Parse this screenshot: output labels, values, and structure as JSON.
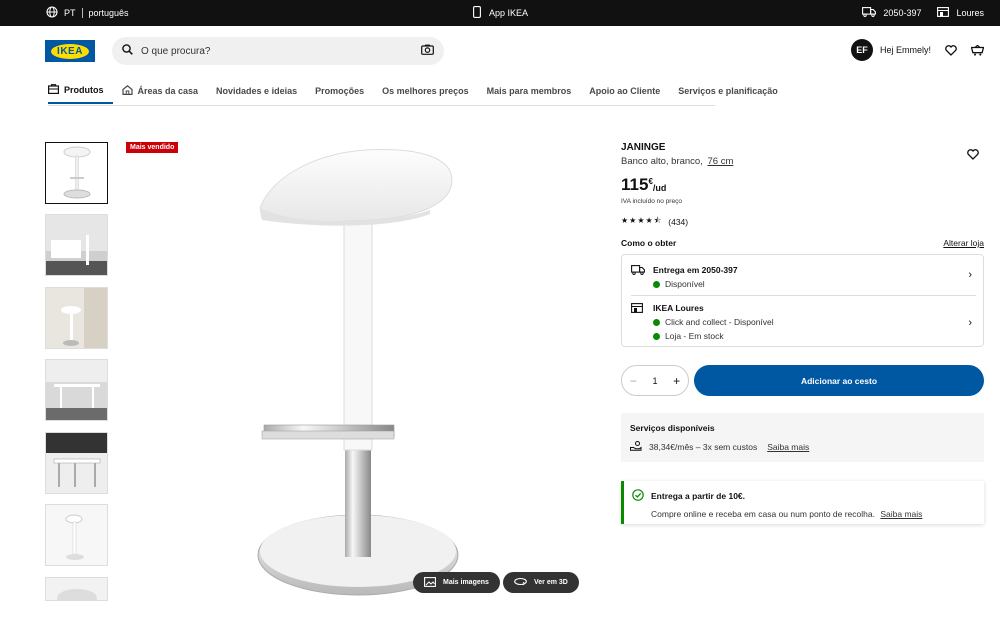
{
  "topbar": {
    "lang_code": "PT",
    "lang_name": "português",
    "app_label": "App IKEA",
    "postcode": "2050-397",
    "store": "Loures"
  },
  "header": {
    "logo_text": "IKEA",
    "search_placeholder": "O que procura?",
    "avatar_initials": "EF",
    "greeting": "Hej Emmely!"
  },
  "nav": {
    "tabs": [
      {
        "label": "Produtos"
      },
      {
        "label": "Áreas da casa"
      },
      {
        "label": "Novidades e ideias"
      },
      {
        "label": "Promoções"
      },
      {
        "label": "Os melhores preços"
      },
      {
        "label": "Mais para membros"
      },
      {
        "label": "Apoio ao Cliente"
      },
      {
        "label": "Serviços e planificação"
      }
    ]
  },
  "gallery": {
    "badge": "Mais vendido",
    "more_images": "Mais imagens",
    "view_3d": "Ver em 3D"
  },
  "product": {
    "name": "JANINGE",
    "description": "Banco alto, branco,",
    "size_link": "76 cm",
    "price_whole": "115",
    "price_currency": "€",
    "price_unit": "/ud",
    "vat_note": "IVA incluído no preço",
    "rating_value": 4.5,
    "rating_count": "(434)"
  },
  "delivery": {
    "section_title": "Como o obter",
    "change_store": "Alterar loja",
    "home_title": "Entrega em 2050-397",
    "home_status": "Disponível",
    "store_title": "IKEA Loures",
    "store_status_1": "Click and collect - Disponível",
    "store_status_2": "Loja - Em stock"
  },
  "purchase": {
    "quantity": "1",
    "add_to_cart": "Adicionar ao cesto"
  },
  "services": {
    "title": "Serviços disponíveis",
    "financing": "38,34€/mês – 3x sem custos",
    "learn_more": "Saiba mais"
  },
  "notice": {
    "title": "Entrega a partir de 10€.",
    "text": "Compre online e receba em casa ou num ponto de recolha.",
    "link": "Saiba mais"
  },
  "colors": {
    "brand_blue": "#0058a3",
    "brand_yellow": "#ffdb00",
    "badge_red": "#cc0008",
    "available_green": "#0a8a00"
  }
}
